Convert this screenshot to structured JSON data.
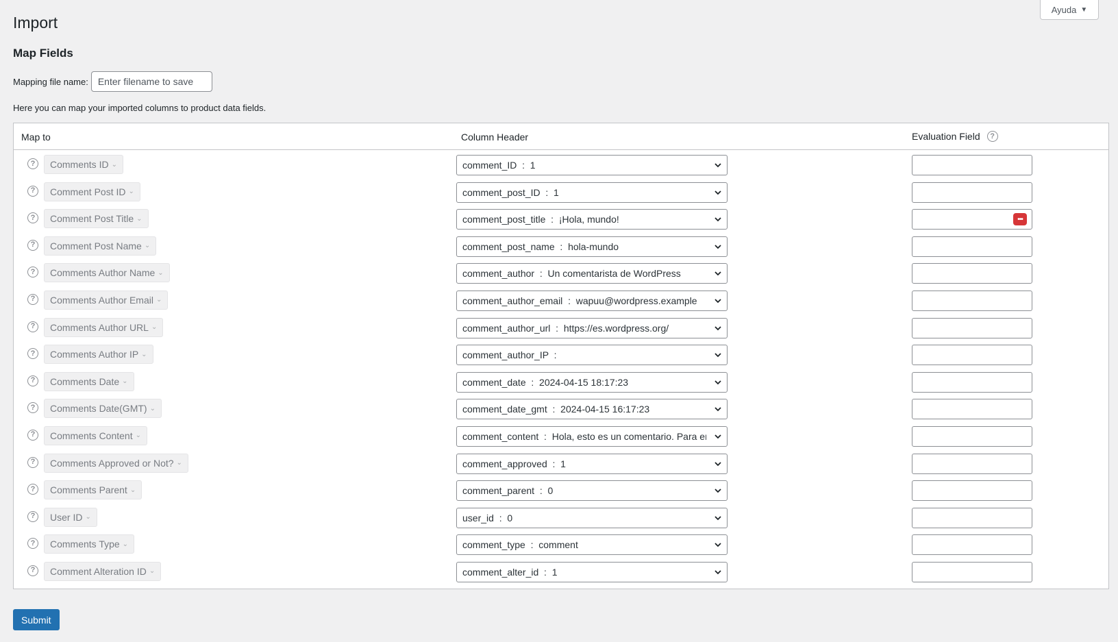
{
  "help_tab": {
    "label": "Ayuda"
  },
  "page_title": "Import",
  "section_title": "Map Fields",
  "mapping": {
    "label": "Mapping file name:",
    "placeholder": "Enter filename to save",
    "value": ""
  },
  "intro_text": "Here you can map your imported columns to product data fields.",
  "table": {
    "headers": {
      "map_to": "Map to",
      "column_header": "Column Header",
      "evaluation_field": "Evaluation Field"
    },
    "rows": [
      {
        "field": "Comments ID",
        "column": "comment_ID  :  1",
        "eval": ""
      },
      {
        "field": "Comment Post ID",
        "column": "comment_post_ID  :  1",
        "eval": ""
      },
      {
        "field": "Comment Post Title",
        "column": "comment_post_title  :  ¡Hola, mundo!",
        "eval": "",
        "password_icon": true
      },
      {
        "field": "Comment Post Name",
        "column": "comment_post_name  :  hola-mundo",
        "eval": ""
      },
      {
        "field": "Comments Author Name",
        "column": "comment_author  :  Un comentarista de WordPress",
        "eval": ""
      },
      {
        "field": "Comments Author Email",
        "column": "comment_author_email  :  wapuu@wordpress.example",
        "eval": ""
      },
      {
        "field": "Comments Author URL",
        "column": "comment_author_url  :  https://es.wordpress.org/",
        "eval": ""
      },
      {
        "field": "Comments Author IP",
        "column": "comment_author_IP  :",
        "eval": ""
      },
      {
        "field": "Comments Date",
        "column": "comment_date  :  2024-04-15 18:17:23",
        "eval": ""
      },
      {
        "field": "Comments Date(GMT)",
        "column": "comment_date_gmt  :  2024-04-15 16:17:23",
        "eval": ""
      },
      {
        "field": "Comments Content",
        "column": "comment_content  :  Hola, esto es un comentario. Para em",
        "eval": ""
      },
      {
        "field": "Comments Approved or Not?",
        "column": "comment_approved  :  1",
        "eval": ""
      },
      {
        "field": "Comments Parent",
        "column": "comment_parent  :  0",
        "eval": ""
      },
      {
        "field": "User ID",
        "column": "user_id  :  0",
        "eval": ""
      },
      {
        "field": "Comments Type",
        "column": "comment_type  :  comment",
        "eval": ""
      },
      {
        "field": "Comment Alteration ID",
        "column": "comment_alter_id  :  1",
        "eval": ""
      }
    ]
  },
  "submit_label": "Submit",
  "colors": {
    "accent": "#2271b1",
    "password_badge": "#d63638",
    "background": "#f0f0f1"
  }
}
